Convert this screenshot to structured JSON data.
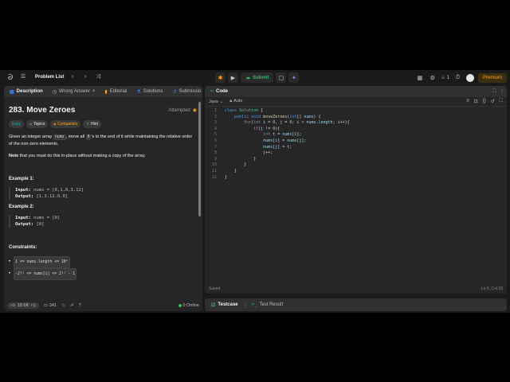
{
  "topbar": {
    "title": "Problem List",
    "submit_label": "Submit",
    "streak": "1",
    "premium_label": "Premium"
  },
  "left": {
    "tabs": [
      {
        "label": "Description",
        "icon": "document-icon"
      },
      {
        "label": "Wrong Answer",
        "icon": "clock-icon"
      },
      {
        "label": "Editorial",
        "icon": "book-icon"
      },
      {
        "label": "Solutions",
        "icon": "flask-icon"
      },
      {
        "label": "Submissio",
        "icon": "history-icon"
      }
    ],
    "title": "283. Move Zeroes",
    "status": "Attempted",
    "tags": [
      {
        "label": "Easy"
      },
      {
        "label": "Topics"
      },
      {
        "label": "Companies"
      },
      {
        "label": "Hint"
      }
    ],
    "desc1_pre": "Given an integer array ",
    "desc1_code1": "nums",
    "desc1_mid": ", move all ",
    "desc1_code2": "0",
    "desc1_post": "'s to the end of it while maintaining the relative order of the non-zero elements.",
    "note_bold": "Note",
    "note_text": " that you must do this in-place without making a copy of the array.",
    "examples": [
      {
        "title": "Example 1:",
        "input_label": "Input:",
        "input": " nums = [0,1,0,3,12]",
        "output_label": "Output:",
        "output": " [1,3,12,0,0]"
      },
      {
        "title": "Example 2:",
        "input_label": "Input:",
        "input": " nums = [0]",
        "output_label": "Output:",
        "output": " [0]"
      }
    ],
    "constraints_title": "Constraints:",
    "constraints": [
      "1 <= nums.length <= 10⁴",
      "-2³¹ <= nums[i] <= 2³¹ - 1"
    ],
    "footer": {
      "likes": "18.6K",
      "comments": "341",
      "online": "0 Online"
    }
  },
  "code": {
    "tab_label": "Code",
    "language": "Java",
    "auto_label": "Auto",
    "status_left": "Saved",
    "status_right": "Ln 5, Col 33",
    "lines": [
      "class Solution {",
      "    public void moveZeroes(int[] nums) {",
      "        for(int i = 0, j = 0; i < nums.length; i++){",
      "            if(j != 0){",
      "                int t = nums[i];",
      "                nums[i] = nums[j];",
      "                nums[j] = t;",
      "                j++;",
      "            }",
      "        }",
      "    }",
      "}"
    ]
  },
  "testcase": {
    "tab1": "Testcase",
    "tab2": "Test Result"
  }
}
